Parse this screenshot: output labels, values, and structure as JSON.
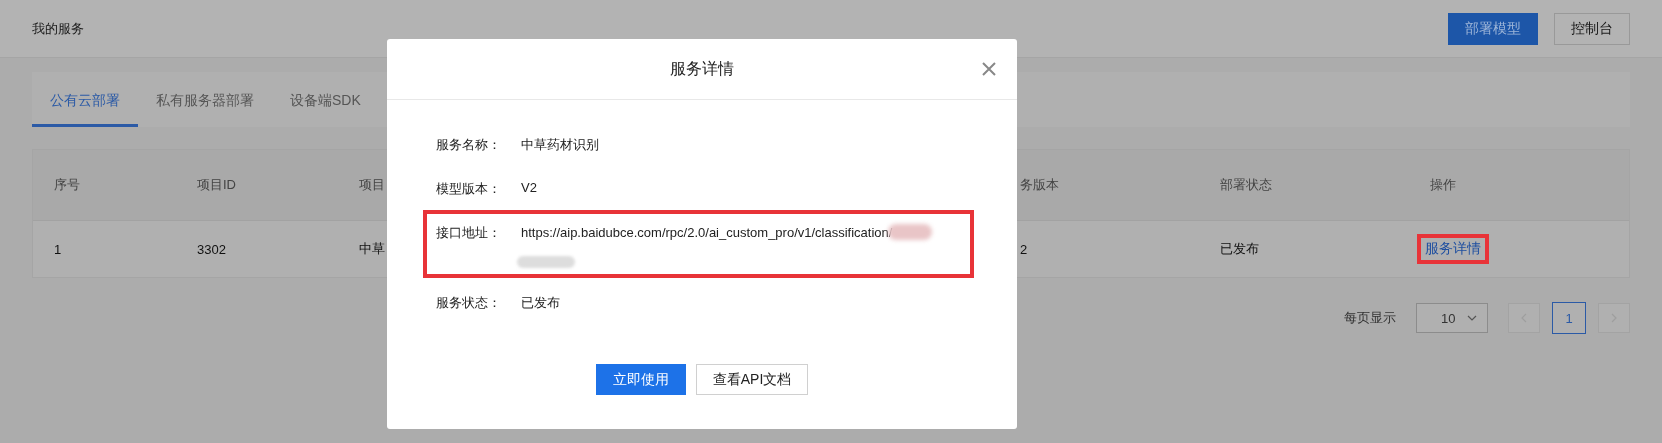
{
  "header": {
    "title": "我的服务",
    "buttons": [
      {
        "label": "部署模型",
        "kind": "primary"
      },
      {
        "label": "控制台",
        "kind": "default"
      }
    ]
  },
  "tabs": [
    {
      "label": "公有云部署",
      "selected": true
    },
    {
      "label": "私有服务器部署",
      "selected": false
    },
    {
      "label": "设备端SDK",
      "selected": false
    }
  ],
  "table": {
    "columns": [
      "序号",
      "项目ID",
      "项目",
      "务版本",
      "部署状态",
      "操作"
    ],
    "rows": [
      {
        "cells": [
          "1",
          "3302",
          "中草",
          "2",
          "已发布"
        ],
        "action": "服务详情",
        "highlighted": true
      }
    ]
  },
  "pagination": {
    "page_size_label": "每页显示",
    "page_size": "10",
    "pages": [
      {
        "label": "1",
        "selected": true
      }
    ]
  },
  "dialog": {
    "title": "服务详情",
    "fields": [
      {
        "label": "服务名称：",
        "value": "中草药材识别",
        "highlighted": false,
        "redacted": false
      },
      {
        "label": "模型版本：",
        "value": "V2",
        "highlighted": false,
        "redacted": false
      },
      {
        "label": "接口地址：",
        "value": "https://aip.baidubce.com/rpc/2.0/ai_custom_pro/v1/classification/",
        "highlighted": true,
        "redacted": true
      },
      {
        "label": "服务状态：",
        "value": "已发布",
        "highlighted": false,
        "redacted": false
      }
    ],
    "buttons": [
      {
        "label": "立即使用",
        "kind": "primary"
      },
      {
        "label": "查看API文档",
        "kind": "default"
      }
    ]
  }
}
